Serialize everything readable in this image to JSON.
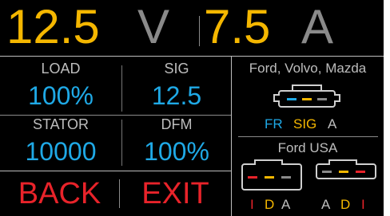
{
  "header": {
    "voltage_value": "12.5",
    "voltage_unit": "V",
    "current_value": "7.5",
    "current_unit": "A"
  },
  "stats": {
    "load_label": "LOAD",
    "load_value": "100%",
    "sig_label": "SIG",
    "sig_value": "12.5",
    "stator_label": "STATOR",
    "stator_value": "10000",
    "dfm_label": "DFM",
    "dfm_value": "100%"
  },
  "buttons": {
    "back_label": "BACK",
    "exit_label": "EXIT"
  },
  "connectors": {
    "group1_title": "Ford, Volvo, Mazda",
    "group1_pins": [
      "FR",
      "SIG",
      "A"
    ],
    "group2_title": "Ford USA",
    "group2_left_pins": [
      "I",
      "D",
      "A"
    ],
    "group2_right_pins": [
      "A",
      "D",
      "I"
    ]
  },
  "colors": {
    "yellow": "#f5b700",
    "blue": "#1fa9e6",
    "red": "#e8232a",
    "gray": "#bdbdbd",
    "background": "#000000"
  }
}
